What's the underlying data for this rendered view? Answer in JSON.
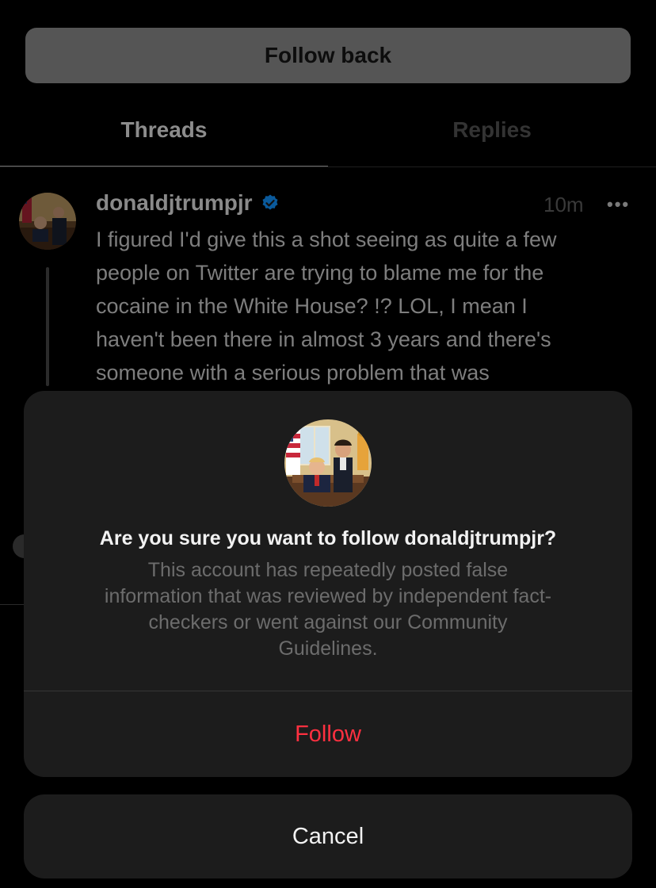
{
  "header": {
    "follow_back_label": "Follow back"
  },
  "tabs": [
    {
      "label": "Threads",
      "selected": true
    },
    {
      "label": "Replies",
      "selected": false
    }
  ],
  "post": {
    "username": "donaldjtrumpjr",
    "verified": true,
    "time": "10m",
    "more_icon": "more-horizontal-icon",
    "text": " I figured I'd give this a shot seeing as quite a few\npeople on Twitter are trying to blame me for the\ncocaine in the White House? !? LOL, I mean I\nhaven't been there in almost 3 years and there's\nsomeone with a serious problem that was"
  },
  "dialog": {
    "title": "Are you sure you want to follow donaldjtrumpjr?",
    "message": "This account has repeatedly posted false\ninformation that was reviewed by independent fact-\ncheckers or went against our Community\nGuidelines.",
    "follow_label": "Follow",
    "cancel_label": "Cancel"
  },
  "colors": {
    "background": "#000000",
    "sheet": "#1c1c1c",
    "destructive": "#ff3040",
    "verified_badge": "#0095f6"
  }
}
